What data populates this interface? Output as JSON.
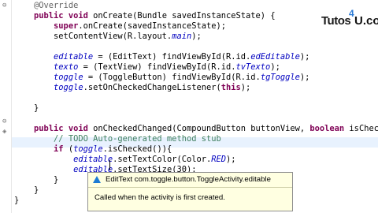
{
  "logo": {
    "part1": "Tutos",
    "part2": "U.com",
    "digit": "4"
  },
  "code": [
    [
      {
        "t": "    "
      },
      {
        "t": "@Override",
        "c": "ann"
      }
    ],
    [
      {
        "t": "    "
      },
      {
        "t": "public void",
        "c": "kw"
      },
      {
        "t": " onCreate(Bundle savedInstanceState) {"
      }
    ],
    [
      {
        "t": "        "
      },
      {
        "t": "super",
        "c": "kw"
      },
      {
        "t": ".onCreate(savedInstanceState);"
      }
    ],
    [
      {
        "t": "        setContentView(R.layout."
      },
      {
        "t": "main",
        "c": "fld"
      },
      {
        "t": ");"
      }
    ],
    [
      {
        "t": ""
      }
    ],
    [
      {
        "t": "        "
      },
      {
        "t": "editable",
        "c": "fld"
      },
      {
        "t": " = (EditText) findViewById(R.id."
      },
      {
        "t": "edEditable",
        "c": "fld"
      },
      {
        "t": ");"
      }
    ],
    [
      {
        "t": "        "
      },
      {
        "t": "texto",
        "c": "fld"
      },
      {
        "t": " = (TextView) findViewById(R.id."
      },
      {
        "t": "tvTexto",
        "c": "fld"
      },
      {
        "t": ");"
      }
    ],
    [
      {
        "t": "        "
      },
      {
        "t": "toggle",
        "c": "fld"
      },
      {
        "t": " = (ToggleButton) findViewById(R.id."
      },
      {
        "t": "tgToggle",
        "c": "fld"
      },
      {
        "t": ");"
      }
    ],
    [
      {
        "t": "        "
      },
      {
        "t": "toggle",
        "c": "fld"
      },
      {
        "t": ".setOnCheckedChangeListener("
      },
      {
        "t": "this",
        "c": "kw"
      },
      {
        "t": ");"
      }
    ],
    [
      {
        "t": ""
      }
    ],
    [
      {
        "t": "    }"
      }
    ],
    [
      {
        "t": ""
      }
    ],
    [
      {
        "t": "    "
      },
      {
        "t": "public void",
        "c": "kw"
      },
      {
        "t": " onCheckedChanged(CompoundButton buttonView, "
      },
      {
        "t": "boolean",
        "c": "kw"
      },
      {
        "t": " isChecke"
      }
    ],
    [
      {
        "t": "        "
      },
      {
        "t": "// TODO Auto-generated method stub",
        "c": "cmt"
      }
    ],
    [
      {
        "t": "        "
      },
      {
        "t": "if",
        "c": "kw"
      },
      {
        "t": " ("
      },
      {
        "t": "toggle",
        "c": "fld"
      },
      {
        "t": ".isChecked()){"
      }
    ],
    [
      {
        "t": "            "
      },
      {
        "t": "editable",
        "c": "fld"
      },
      {
        "t": ".setTextColor(Color."
      },
      {
        "t": "RED",
        "c": "fld"
      },
      {
        "t": ");"
      }
    ],
    [
      {
        "t": "            "
      },
      {
        "t": "editable",
        "c": "fld"
      },
      {
        "t": ".setTextSize(30);"
      }
    ],
    [
      {
        "t": "        }"
      }
    ],
    [
      {
        "t": "    }"
      }
    ],
    [
      {
        "t": "}"
      }
    ]
  ],
  "tooltip": {
    "title": "EditText com.toggle.button.ToggleActivity.editable",
    "body": "Called when the activity is first created."
  }
}
